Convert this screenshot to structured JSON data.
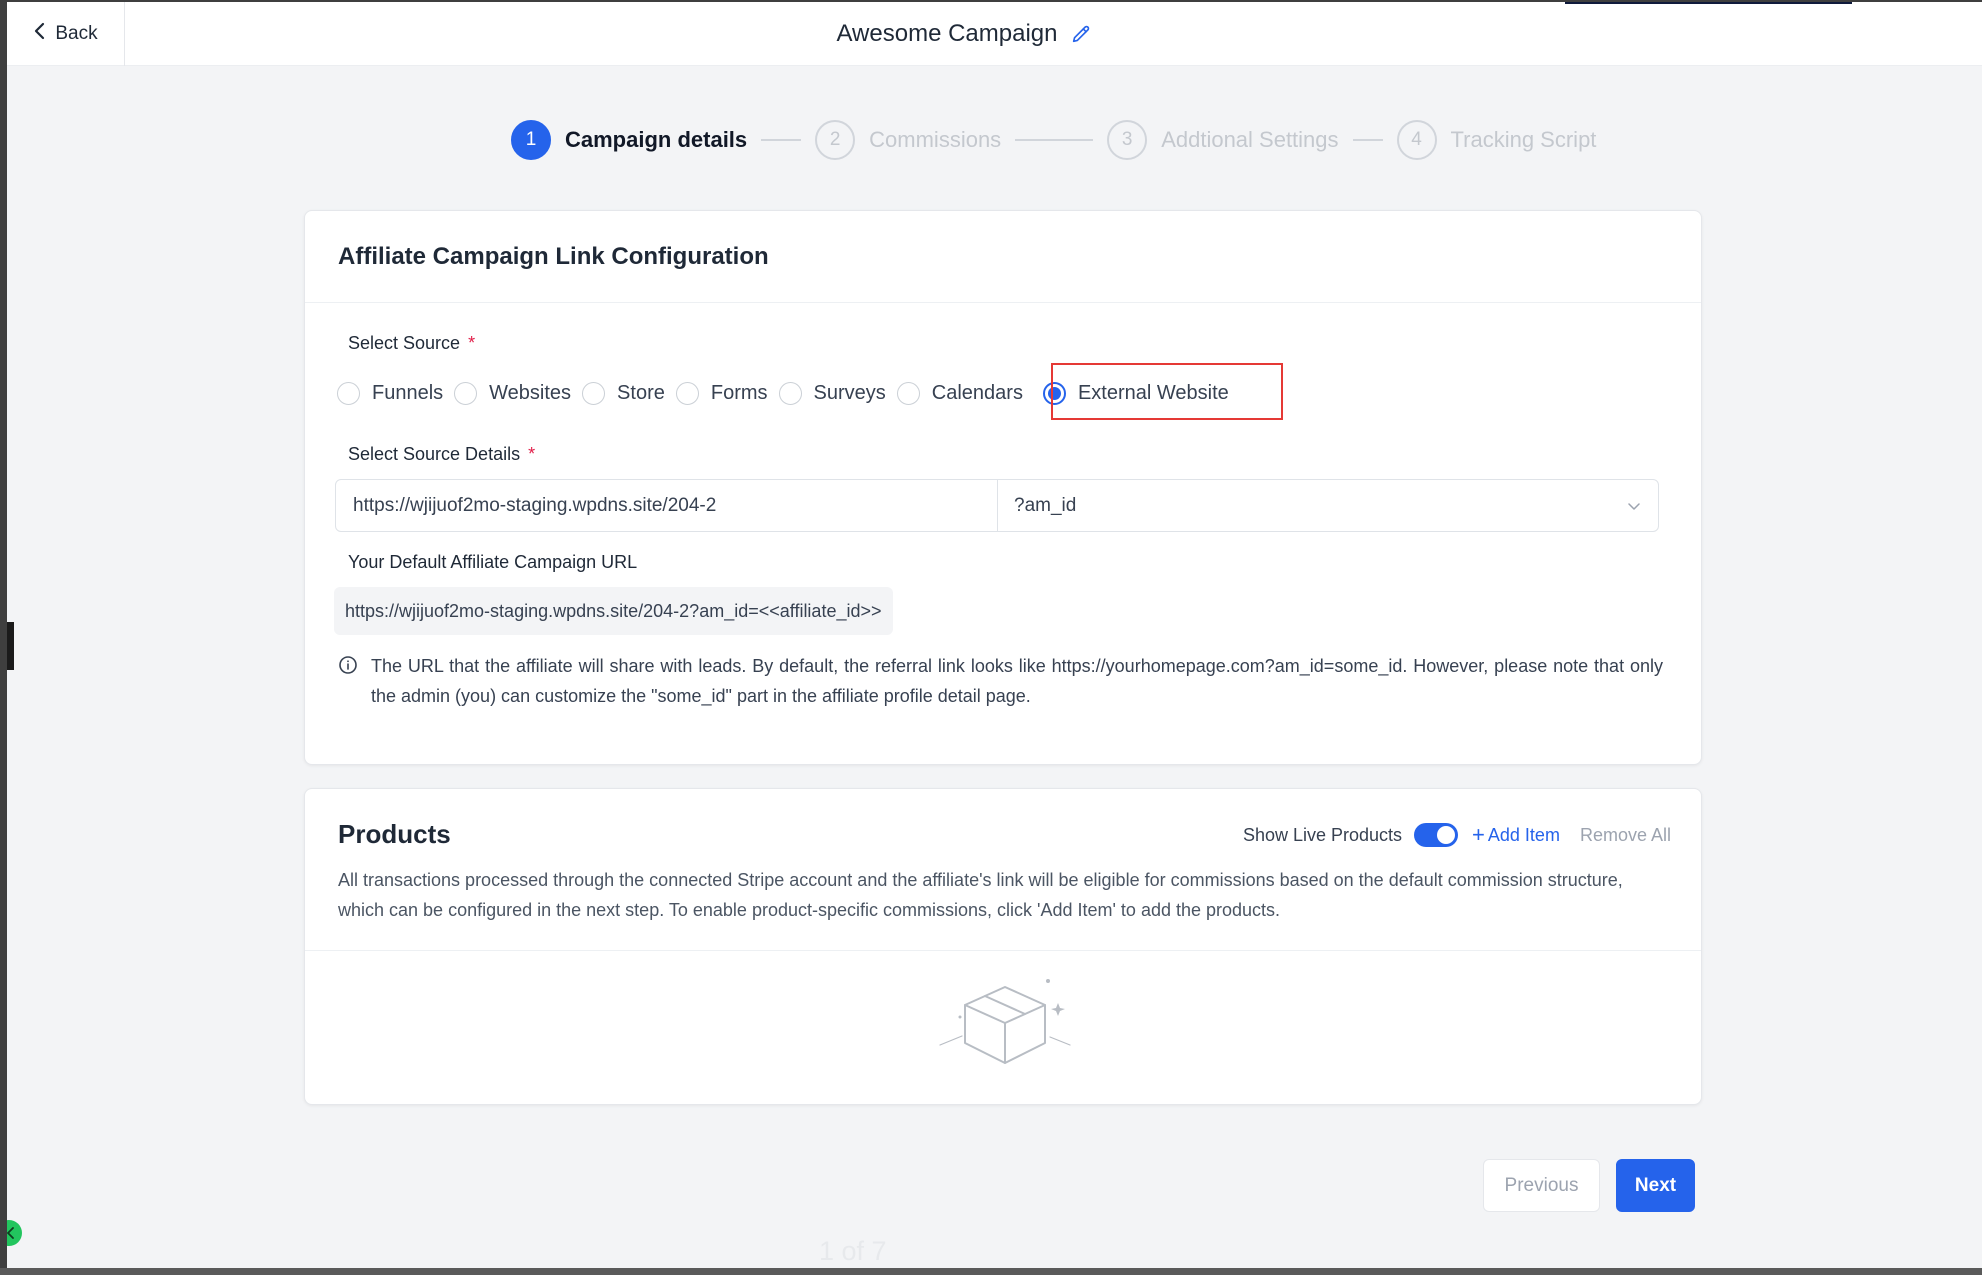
{
  "header": {
    "back_label": "Back",
    "title": "Awesome Campaign"
  },
  "stepper": {
    "steps": [
      {
        "number": "1",
        "label": "Campaign details"
      },
      {
        "number": "2",
        "label": "Commissions"
      },
      {
        "number": "3",
        "label": "Addtional Settings"
      },
      {
        "number": "4",
        "label": "Tracking Script"
      }
    ]
  },
  "link_config": {
    "title": "Affiliate Campaign Link Configuration",
    "select_source_label": "Select Source",
    "required_mark": "*",
    "sources": [
      "Funnels",
      "Websites",
      "Store",
      "Forms",
      "Surveys",
      "Calendars",
      "External Website"
    ],
    "selected_source": "External Website",
    "source_details_label": "Select Source Details",
    "source_url_value": "https://wjijuof2mo-staging.wpdns.site/204-2",
    "param_value": "?am_id",
    "default_url_label": "Your Default Affiliate Campaign URL",
    "default_url_value": "https://wjijuof2mo-staging.wpdns.site/204-2?am_id=<<affiliate_id>>",
    "info_text": "The URL that the affiliate will share with leads. By default, the referral link looks like https://yourhomepage.com?am_id=some_id. However, please note that only the admin (you) can customize the \"some_id\" part in the affiliate profile detail page."
  },
  "products": {
    "title": "Products",
    "show_live_label": "Show Live Products",
    "show_live_on": true,
    "add_item_label": "Add Item",
    "remove_all_label": "Remove All",
    "description": "All transactions processed through the connected Stripe account and the affiliate's link will be eligible for commissions based on the default commission structure, which can be configured in the next step. To enable product-specific commissions, click 'Add Item' to add the products."
  },
  "footer": {
    "previous_label": "Previous",
    "next_label": "Next",
    "page_indicator": "1 of 7"
  },
  "colors": {
    "primary": "#2563eb",
    "highlight": "#e53935",
    "required": "#e11d48",
    "handle": "#22c55e"
  },
  "icons": {
    "back": "chevron-left-icon",
    "edit": "pencil-icon",
    "dropdown": "chevron-down-icon",
    "info": "info-icon",
    "empty": "box-icon",
    "collapse": "chevron-left-icon"
  }
}
